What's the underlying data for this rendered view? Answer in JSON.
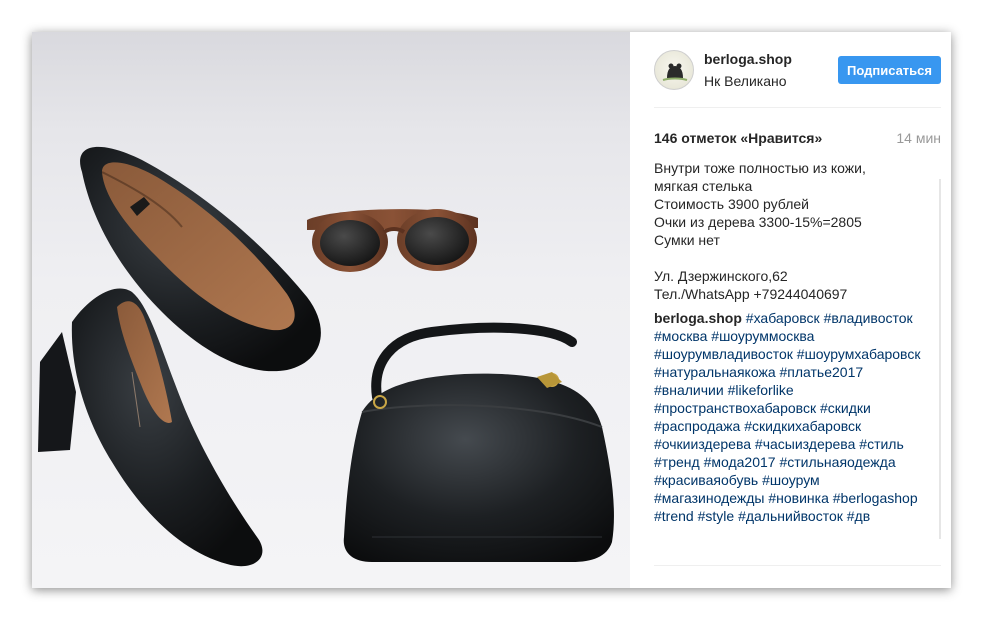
{
  "post": {
    "username": "berloga.shop",
    "location": "Нк Великано",
    "follow_label": "Подписаться",
    "likes": "146 отметок «Нравится»",
    "time": "14 мин",
    "caption": "Внутри тоже полностью из кожи,\nмягкая стелька\nСтоимость 3900 рублей\nОчки из дерева 3300-15%=2805\nСумки нет\n\nУл. Дзержинского,62\nТел./WhatsApp +79244040697",
    "comment_author": "berloga.shop",
    "hashtags": [
      "#хабаровск",
      "#владивосток",
      "#москва",
      "#шоуруммосква",
      "#шоурумвладивосток",
      "#шоурумхабаровск",
      "#натуральнаякожа",
      "#платье2017",
      "#вналичии",
      "#likeforlike",
      "#пространствохабаровск",
      "#скидки",
      "#распродажа",
      "#скидкихабаровск",
      "#очкииздерева",
      "#часыиздерева",
      "#стиль",
      "#тренд",
      "#мода2017",
      "#стильнаяодежда",
      "#красиваяобувь",
      "#шоурум",
      "#магазинодежды",
      "#новинка",
      "#berlogashop",
      "#trend",
      "#style",
      "#дальнийвосток",
      "#дв"
    ],
    "colors": {
      "follow_bg": "#3897f0",
      "hashtag": "#003569",
      "time": "#999999"
    }
  },
  "icons": {
    "avatar": "bear-logo-avatar"
  }
}
